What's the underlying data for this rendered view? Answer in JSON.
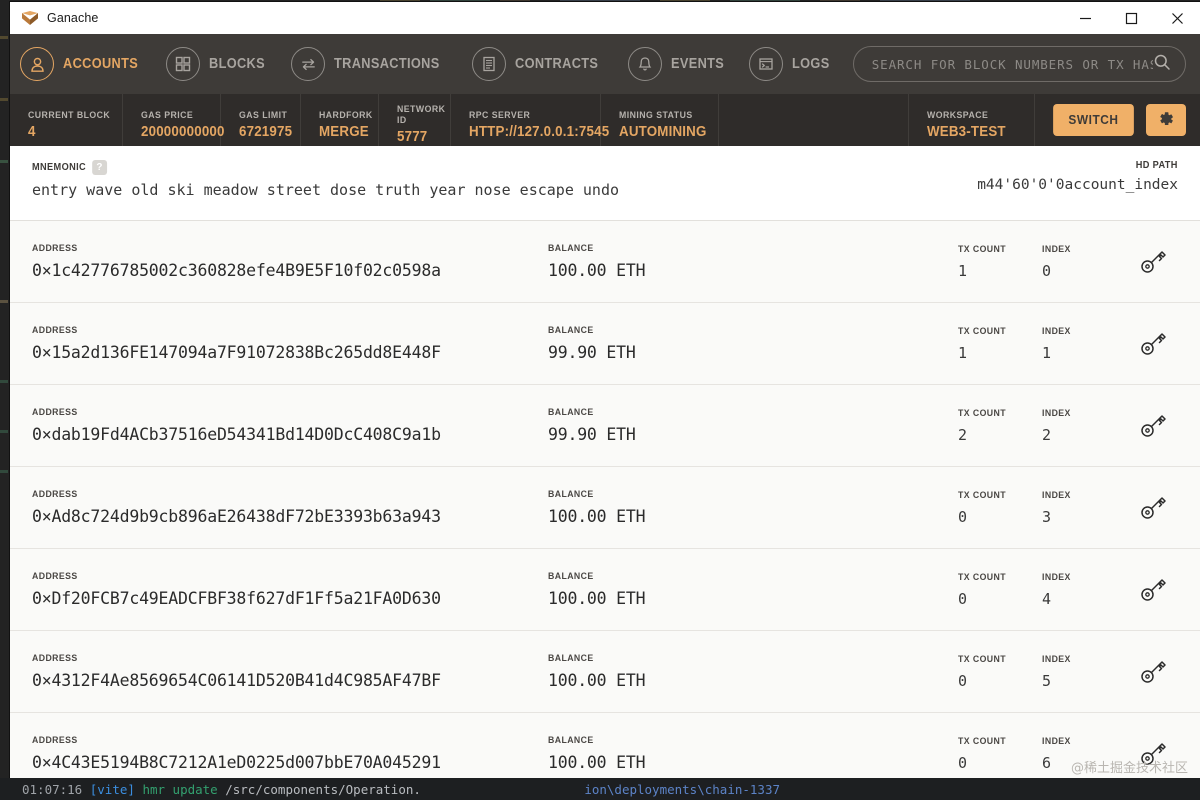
{
  "window": {
    "title": "Ganache",
    "app_icon": "cube-icon",
    "controls": [
      {
        "name": "minimize",
        "glyph": "minimize-icon"
      },
      {
        "name": "maximize",
        "glyph": "maximize-icon"
      },
      {
        "name": "close",
        "glyph": "close-icon"
      }
    ]
  },
  "nav": {
    "items": [
      {
        "label": "ACCOUNTS",
        "icon": "user-icon",
        "active": true
      },
      {
        "label": "BLOCKS",
        "icon": "grid-icon",
        "active": false
      },
      {
        "label": "TRANSACTIONS",
        "icon": "exchange-icon",
        "active": false
      },
      {
        "label": "CONTRACTS",
        "icon": "document-icon",
        "active": false
      },
      {
        "label": "EVENTS",
        "icon": "bell-icon",
        "active": false
      },
      {
        "label": "LOGS",
        "icon": "terminal-icon",
        "active": false
      }
    ],
    "search": {
      "placeholder": "SEARCH FOR BLOCK NUMBERS OR TX HASHES",
      "value": "",
      "icon": "search-icon"
    }
  },
  "status": {
    "items": [
      {
        "label": "CURRENT BLOCK",
        "value": "4"
      },
      {
        "label": "GAS PRICE",
        "value": "20000000000"
      },
      {
        "label": "GAS LIMIT",
        "value": "6721975"
      },
      {
        "label": "HARDFORK",
        "value": "MERGE"
      },
      {
        "label": "NETWORK ID",
        "value": "5777"
      },
      {
        "label": "RPC SERVER",
        "value": "HTTP://127.0.0.1:7545"
      },
      {
        "label": "MINING STATUS",
        "value": "AUTOMINING"
      }
    ],
    "workspace": {
      "label": "WORKSPACE",
      "value": "WEB3-TEST"
    },
    "switch_label": "SWITCH",
    "settings_icon": "gear-icon"
  },
  "mnemonic": {
    "label": "MNEMONIC",
    "help_glyph": "?",
    "words": "entry wave old ski meadow street dose truth year nose escape undo"
  },
  "hdpath": {
    "label": "HD PATH",
    "value": "m44'60'0'0account_index"
  },
  "columns": {
    "address": "ADDRESS",
    "balance": "BALANCE",
    "tx_count": "TX COUNT",
    "index": "INDEX"
  },
  "accounts": [
    {
      "address": "0×1c42776785002c360828efe4B9E5F10f02c0598a",
      "balance": "100.00 ETH",
      "tx_count": "1",
      "index": "0",
      "key_icon": "key-icon"
    },
    {
      "address": "0×15a2d136FE147094a7F91072838Bc265dd8E448F",
      "balance": "99.90 ETH",
      "tx_count": "1",
      "index": "1",
      "key_icon": "key-icon"
    },
    {
      "address": "0×dab19Fd4ACb37516eD54341Bd14D0DcC408C9a1b",
      "balance": "99.90 ETH",
      "tx_count": "2",
      "index": "2",
      "key_icon": "key-icon"
    },
    {
      "address": "0×Ad8c724d9b9cb896aE26438dF72bE3393b63a943",
      "balance": "100.00 ETH",
      "tx_count": "0",
      "index": "3",
      "key_icon": "key-icon"
    },
    {
      "address": "0×Df20FCB7c49EADCFBF38f627dF1Ff5a21FA0D630",
      "balance": "100.00 ETH",
      "tx_count": "0",
      "index": "4",
      "key_icon": "key-icon"
    },
    {
      "address": "0×4312F4Ae8569654C06141D520B41d4C985AF47BF",
      "balance": "100.00 ETH",
      "tx_count": "0",
      "index": "5",
      "key_icon": "key-icon"
    },
    {
      "address": "0×4C43E5194B8C7212A1eD0225d007bbE70A045291",
      "balance": "100.00 ETH",
      "tx_count": "0",
      "index": "6",
      "key_icon": "key-icon"
    }
  ],
  "terminal": {
    "time": "01:07:16",
    "tag": "[vite]",
    "event": "hmr update",
    "path": "/src/components/Operation.",
    "right_text": "ion\\deployments\\chain-1337"
  },
  "watermark": "@稀土掘金技术社区",
  "colors": {
    "accent": "#e4a663",
    "nav_bg": "#3e3b38",
    "status_bg": "#2f2c2a",
    "button": "#f0b068",
    "page_bg": "#fafaf8"
  }
}
